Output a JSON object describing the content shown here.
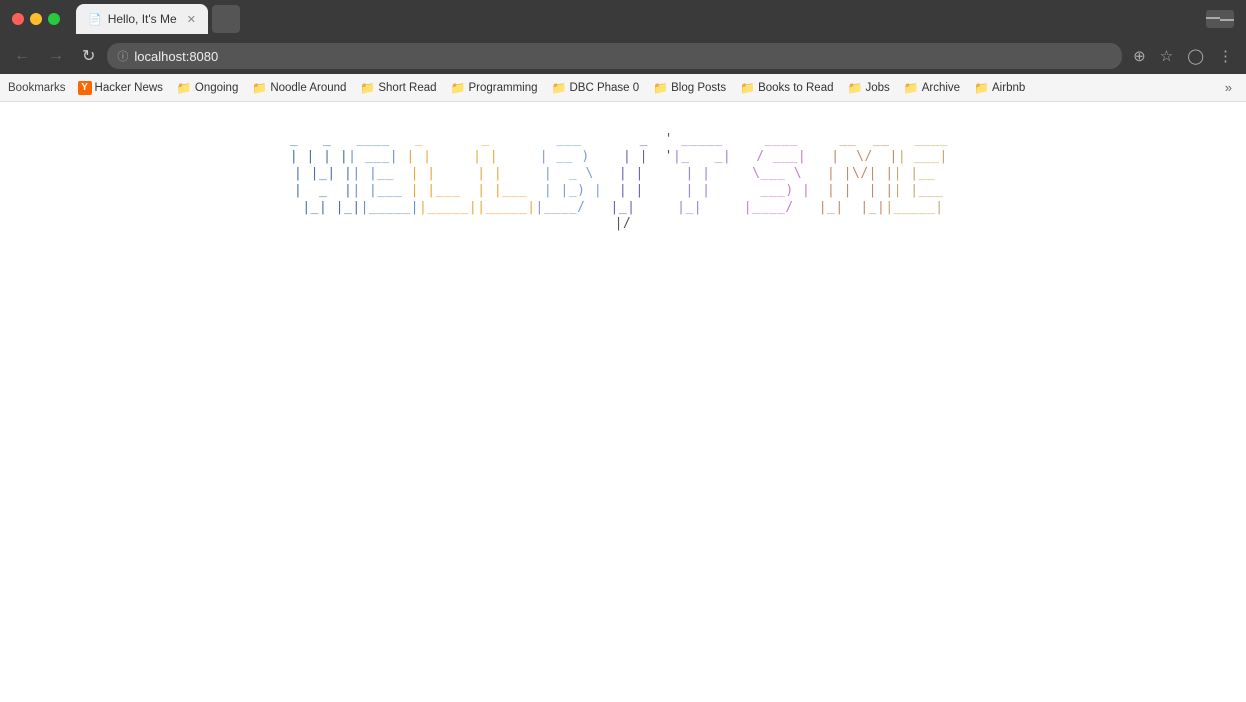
{
  "titleBar": {
    "tab": {
      "title": "Hello, It's Me",
      "icon": "📄"
    }
  },
  "navBar": {
    "url": "localhost:8080",
    "backBtn": "←",
    "forwardBtn": "→",
    "refreshBtn": "↻",
    "zoomIcon": "⊕",
    "starIcon": "☆",
    "castIcon": "▭",
    "moreIcon": "⋮"
  },
  "bookmarksBar": {
    "label": "Bookmarks",
    "items": [
      {
        "name": "Hacker News",
        "type": "y"
      },
      {
        "name": "Ongoing",
        "type": "folder"
      },
      {
        "name": "Noodle Around",
        "type": "folder"
      },
      {
        "name": "Short Read",
        "type": "folder"
      },
      {
        "name": "Programming",
        "type": "folder"
      },
      {
        "name": "DBC Phase 0",
        "type": "folder"
      },
      {
        "name": "Blog Posts",
        "type": "folder"
      },
      {
        "name": "Books to Read",
        "type": "folder"
      },
      {
        "name": "Jobs",
        "type": "folder"
      },
      {
        "name": "Archive",
        "type": "folder"
      },
      {
        "name": "Airbnb",
        "type": "folder"
      }
    ],
    "more": "»"
  },
  "content": {
    "asciiTitle": "Hello, It's Me"
  }
}
